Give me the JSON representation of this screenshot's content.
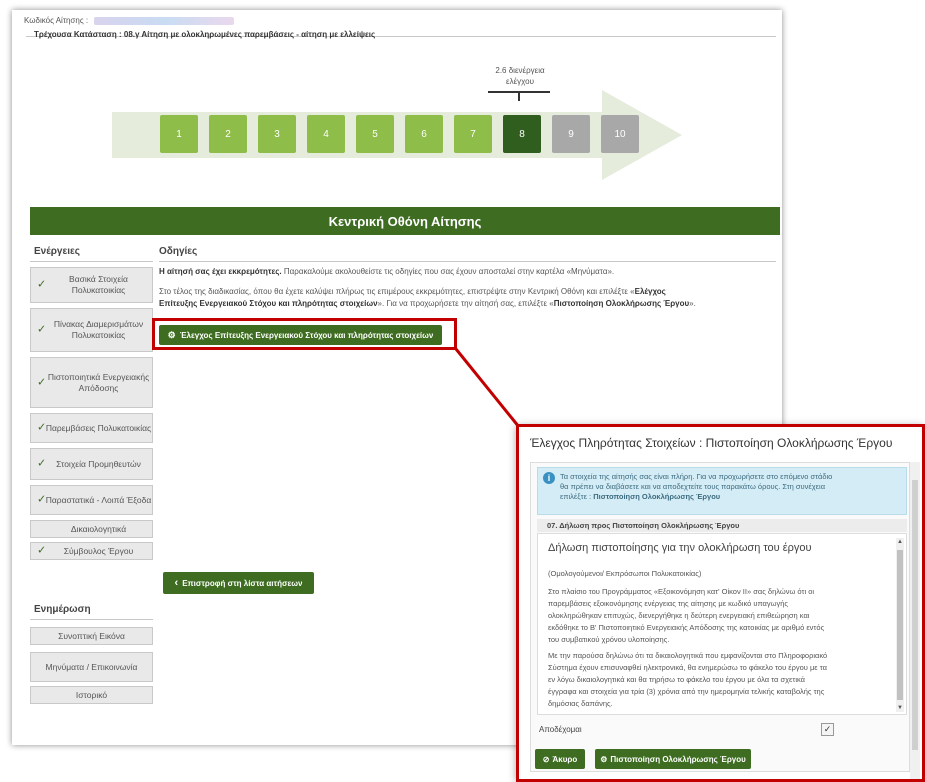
{
  "application": {
    "code_label": "Κωδικός Αίτησης :",
    "status_label": "Τρέχουσα Κατάσταση : 08.γ Αίτηση με ολοκληρωμένες παρεμβάσεις - αίτηση με ελλείψεις"
  },
  "progress": {
    "current_stage_label": "2.6 διενέργεια ελέγχου",
    "current_step": 8,
    "steps": [
      {
        "label": "1",
        "state": "done"
      },
      {
        "label": "2",
        "state": "done"
      },
      {
        "label": "3",
        "state": "done"
      },
      {
        "label": "4",
        "state": "done"
      },
      {
        "label": "5",
        "state": "done"
      },
      {
        "label": "6",
        "state": "done"
      },
      {
        "label": "7",
        "state": "done"
      },
      {
        "label": "8",
        "state": "current"
      },
      {
        "label": "9",
        "state": "pending"
      },
      {
        "label": "10",
        "state": "pending"
      }
    ]
  },
  "main_title": "Κεντρική Οθόνη Αίτησης",
  "sidebar": {
    "actions_heading": "Ενέργειες",
    "actions": [
      {
        "label": "Βασικά Στοιχεία Πολυκατοικίας",
        "checked": true
      },
      {
        "label": "Πίνακας Διαμερισμάτων Πολυκατοικίας",
        "checked": true
      },
      {
        "label": "Πιστοποιητικά Ενεργειακής Απόδοσης",
        "checked": true
      },
      {
        "label": "Παρεμβάσεις Πολυκατοικίας",
        "checked": true
      },
      {
        "label": "Στοιχεία Προμηθευτών",
        "checked": true
      },
      {
        "label": "Παραστατικά - Λοιπά Έξοδα",
        "checked": true
      },
      {
        "label": "Δικαιολογητικά",
        "checked": false
      },
      {
        "label": "Σύμβουλος Έργου",
        "checked": true
      }
    ],
    "info_heading": "Ενημέρωση",
    "info_items": [
      {
        "label": "Συνοπτική Εικόνα"
      },
      {
        "label": "Μηνύματα / Επικοινωνία"
      },
      {
        "label": "Ιστορικό"
      }
    ]
  },
  "instructions": {
    "heading": "Οδηγίες",
    "pending_bold": "Η αίτησή σας έχει εκκρεμότητες.",
    "pending_text": " Παρακαλούμε ακολουθείστε τις οδηγίες που σας έχουν αποσταλεί στην καρτέλα «Μηνύματα».",
    "line2_text": "Στο τέλος της διαδικασίας, όπου θα έχετε καλύψει πλήρως τις επιμέρους εκκρεμότητες, επιστρέψτε στην Κεντρική Οθόνη και επιλέξτε «",
    "line2_bold": "Ελέγχος",
    "line3_bold": "Επίτευξης Ενεργειακού Στόχου και πληρότητας στοιχείων",
    "line3_text": "». Για να προχωρήσετε την αίτησή σας, επιλέξτε «",
    "line3_bold2": "Πιστοποίηση Ολοκλήρωσης Έργου",
    "line3_end": "»."
  },
  "check_button": {
    "label": "Έλεγχος Επίτευξης Ενεργειακού Στόχου και πληρότητας στοιχείων"
  },
  "back_button": {
    "label": "Επιστροφή στη λίστα αιτήσεων"
  },
  "modal": {
    "title": "Έλεγχος Πληρότητας Στοιχείων : Πιστοποίηση Ολοκλήρωσης Έργου",
    "alert_line1": "Τα στοιχεία της αίτησής σας είναι πλήρη. Για να προχωρήσετε στο επόμενο στάδιο",
    "alert_line2": "θα πρέπει να διαβάσετε και να αποδεχτείτε τους παρακάτω όρους. Στη συνέχεια",
    "alert_line3_prefix": "επιλέξτε : ",
    "alert_line3_bold": "Πιστοποίηση Ολοκλήρωσης Έργου",
    "declaration_heading": "07. Δήλωση προς Πιστοποίηση Ολοκλήρωσης Έργου",
    "declaration_title": "Δήλωση πιστοποίησης για την ολοκλήρωση του έργου",
    "declarant_line": "(Ομολογούμενοι/ Εκπρόσωποι Πολυκατοικίας)",
    "para1": [
      "Στο πλαίσιο του Προγράμματος «Εξοικονόμηση κατ' Οίκον ΙΙ» σας δηλώνω ότι οι",
      "παρεμβάσεις εξοικονόμησης ενέργειας της αίτησης με κωδικό υπαγωγής",
      "ολοκληρώθηκαν επιτυχώς, διενεργήθηκε η δεύτερη ενεργειακή επιθεώρηση και",
      "εκδόθηκε το Β' Πιστοποιητικό Ενεργειακής Απόδοσης της κατοικίας με αριθμό εντός",
      "του συμβατικού χρόνου υλοποίησης."
    ],
    "para2": [
      "Με την παρούσα δηλώνω ότι τα δικαιολογητικά που εμφανίζονται στο Πληροφοριακό",
      "Σύστημα έχουν επισυναφθεί ηλεκτρονικά, θα ενημερώσω το φάκελο του έργου με τα",
      "εν λόγω δικαιολογητικά και θα τηρήσω το φάκελο του έργου με όλα τα σχετικά",
      "έγγραφα και στοιχεία για τρία (3) χρόνια από την ημερομηνία τελικής καταβολής της",
      "δημόσιας δαπάνης."
    ],
    "accept_label": "Αποδέχομαι",
    "accept_checked": true,
    "cancel_label": "Άκυρο",
    "confirm_label": "Πιστοποίηση Ολοκλήρωσης Έργου"
  },
  "colors": {
    "primary_green": "#3e6d22",
    "step_done": "#8ebd4a",
    "step_current": "#2f5e1e",
    "step_pending": "#a8a8a8",
    "highlight_red": "#c30000",
    "alert_bg": "#d4ecf5"
  },
  "icons": {
    "check": "check-icon",
    "back": "chevron-left-icon",
    "info": "info-icon",
    "gear": "settings-icon",
    "close": "close-icon"
  }
}
